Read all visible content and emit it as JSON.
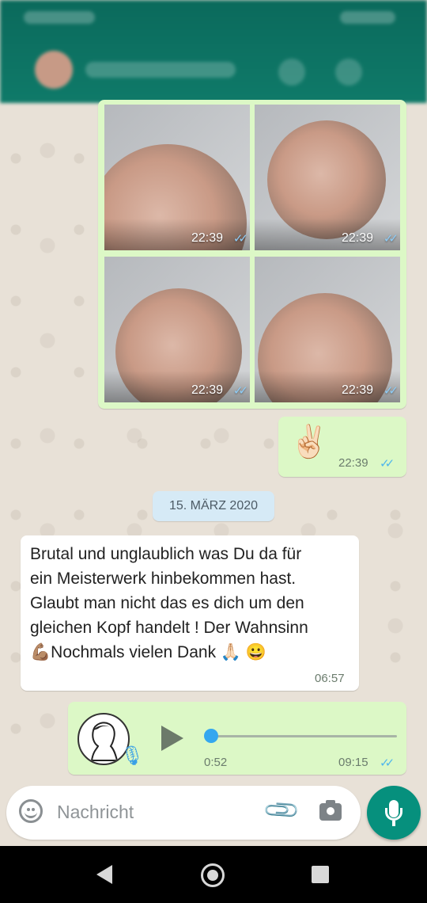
{
  "photo_grid": {
    "photos": [
      {
        "time": "22:39",
        "ticks": "✓✓"
      },
      {
        "time": "22:39",
        "ticks": "✓✓"
      },
      {
        "time": "22:39",
        "ticks": "✓✓"
      },
      {
        "time": "22:39",
        "ticks": "✓✓"
      }
    ]
  },
  "emoji_message": {
    "emoji": "✌🏻",
    "time": "22:39",
    "ticks": "✓✓"
  },
  "date_divider": "15. MÄRZ 2020",
  "incoming_message": {
    "lines": [
      "Brutal und unglaublich was Du da für",
      "ein Meisterwerk hinbekommen hast.",
      "Glaubt man nicht das es dich um den",
      "gleichen Kopf handelt ! Der Wahnsinn",
      "💪🏽Nochmals vielen Dank 🙏🏻 😀"
    ],
    "time": "06:57"
  },
  "voice_message": {
    "duration": "0:52",
    "time": "09:15",
    "ticks": "✓✓",
    "progress": 0.0
  },
  "composer": {
    "placeholder": "Nachricht"
  },
  "colors": {
    "outgoing": "#dcf8c6",
    "incoming": "#ffffff",
    "accent": "#06907d",
    "read_ticks": "#4fb6ec"
  },
  "icons": [
    "emoji-icon",
    "paperclip-icon",
    "camera-icon",
    "mic-icon",
    "play-icon",
    "back-icon",
    "home-icon",
    "recents-icon"
  ]
}
